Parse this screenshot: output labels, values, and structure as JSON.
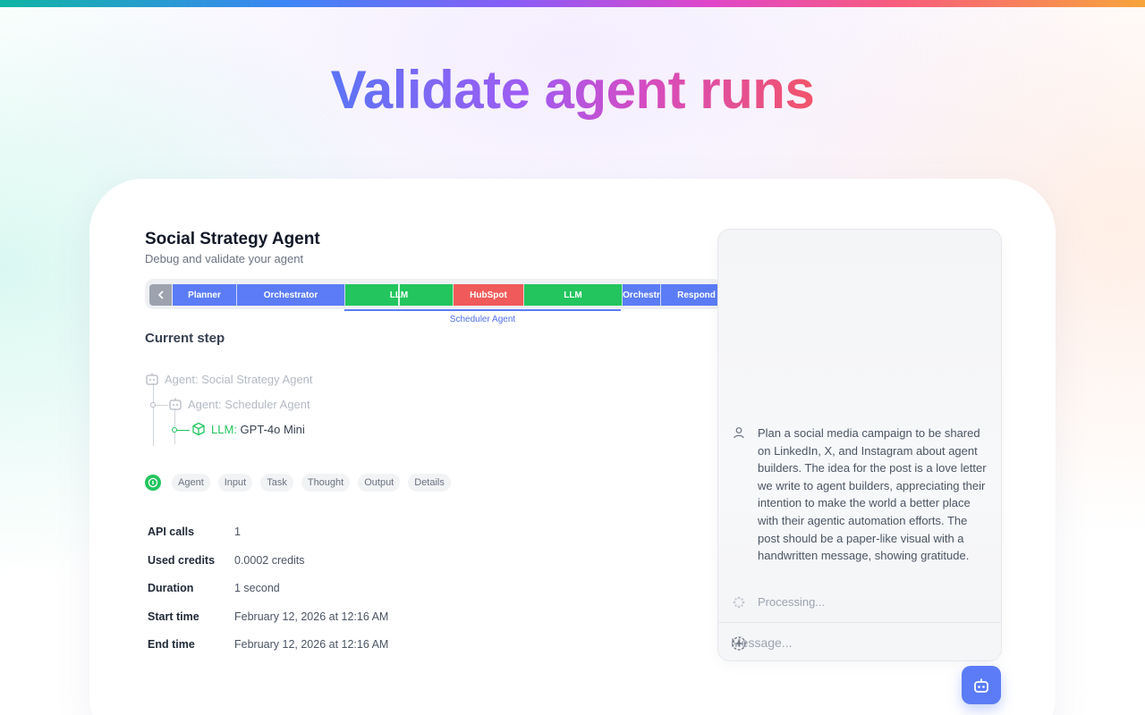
{
  "headline": "Validate agent runs",
  "page": {
    "title": "Social Strategy Agent",
    "subtitle": "Debug and validate your agent"
  },
  "timeline": {
    "segments": [
      {
        "label": "Planner",
        "color": "#5b7cf6"
      },
      {
        "label": "Orchestrator",
        "color": "#5b7cf6"
      },
      {
        "label": "LLM",
        "color": "#22c55e"
      },
      {
        "label": "HubSpot",
        "color": "#f05a5a"
      },
      {
        "label": "LLM",
        "color": "#22c55e"
      },
      {
        "label": "Orchestr",
        "color": "#5b7cf6"
      },
      {
        "label": "Respond",
        "color": "#5b7cf6"
      }
    ],
    "group_label": "Scheduler Agent"
  },
  "current_step": {
    "title": "Current step",
    "tree": [
      {
        "prefix": "Agent:",
        "name": "Social Strategy Agent"
      },
      {
        "prefix": "Agent:",
        "name": "Scheduler Agent"
      },
      {
        "prefix": "LLM:",
        "name": "GPT-4o Mini"
      }
    ]
  },
  "tabs": [
    "Agent",
    "Input",
    "Task",
    "Thought",
    "Output",
    "Details"
  ],
  "details": [
    {
      "label": "API calls",
      "value": "1"
    },
    {
      "label": "Used credits",
      "value": "0.0002 credits"
    },
    {
      "label": "Duration",
      "value": "1 second"
    },
    {
      "label": "Start time",
      "value": "February 12, 2026 at 12:16 AM"
    },
    {
      "label": "End time",
      "value": "February 12, 2026 at 12:16 AM"
    }
  ],
  "chat": {
    "user_message": "Plan a social media campaign to be shared on LinkedIn, X, and Instagram about agent builders. The idea for the post is a love letter we write to agent builders, appreciating their intention to make the world a better place with their agentic automation efforts. The post should be a paper-like visual with a handwritten message, showing gratitude.",
    "status": "Processing...",
    "input_placeholder": "Message..."
  },
  "colors": {
    "accent_blue": "#5b7cf6",
    "success_green": "#22c55e",
    "error_red": "#f05a5a"
  },
  "icons": {
    "agent": "robot-icon",
    "llm": "cube-icon",
    "user": "user-icon",
    "processing": "spinner-icon",
    "send": "send-icon",
    "fab": "robot-icon"
  }
}
